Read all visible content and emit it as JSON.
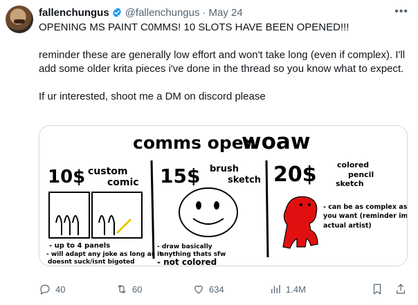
{
  "user": {
    "name": "fallenchungus",
    "handle": "@fallenchungus",
    "separator": "·",
    "date": "May 24"
  },
  "tweet": {
    "lines": [
      "OPENING MS PAINT C0MMS! 10 SLOTS HAVE BEEN OPENED!!!",
      "reminder these are generally low effort and won't take long (even if complex). I'll add some older krita pieces i've done in the thread so you know what to expect.",
      "If ur interested, shoot me a DM on discord please"
    ]
  },
  "image": {
    "title_a": "comms open",
    "title_b": "woaw",
    "price1": "10$",
    "label1_a": "custom",
    "label1_b": "comic",
    "note1_a": "- up to 4 panels",
    "note1_b": "- will adapt any joke as long as it",
    "note1_c": "doesnt suck/isnt bigoted",
    "price2": "15$",
    "label2_a": "brush",
    "label2_b": "sketch",
    "note2_a": "- draw basically",
    "note2_b": "anything thats sfw",
    "note2_c": "- not colored",
    "price3": "20$",
    "label3_a": "colored",
    "label3_b": "pencil",
    "label3_c": "sketch",
    "note3_a": "- can be as complex as",
    "note3_b": "you want (reminder im an",
    "note3_c": "actual artist)"
  },
  "actions": {
    "replies": "40",
    "reposts": "60",
    "likes": "634",
    "views": "1.4M"
  },
  "colors": {
    "verified": "#1d9bf0",
    "muted": "#536471",
    "art_red": "#e01010"
  }
}
